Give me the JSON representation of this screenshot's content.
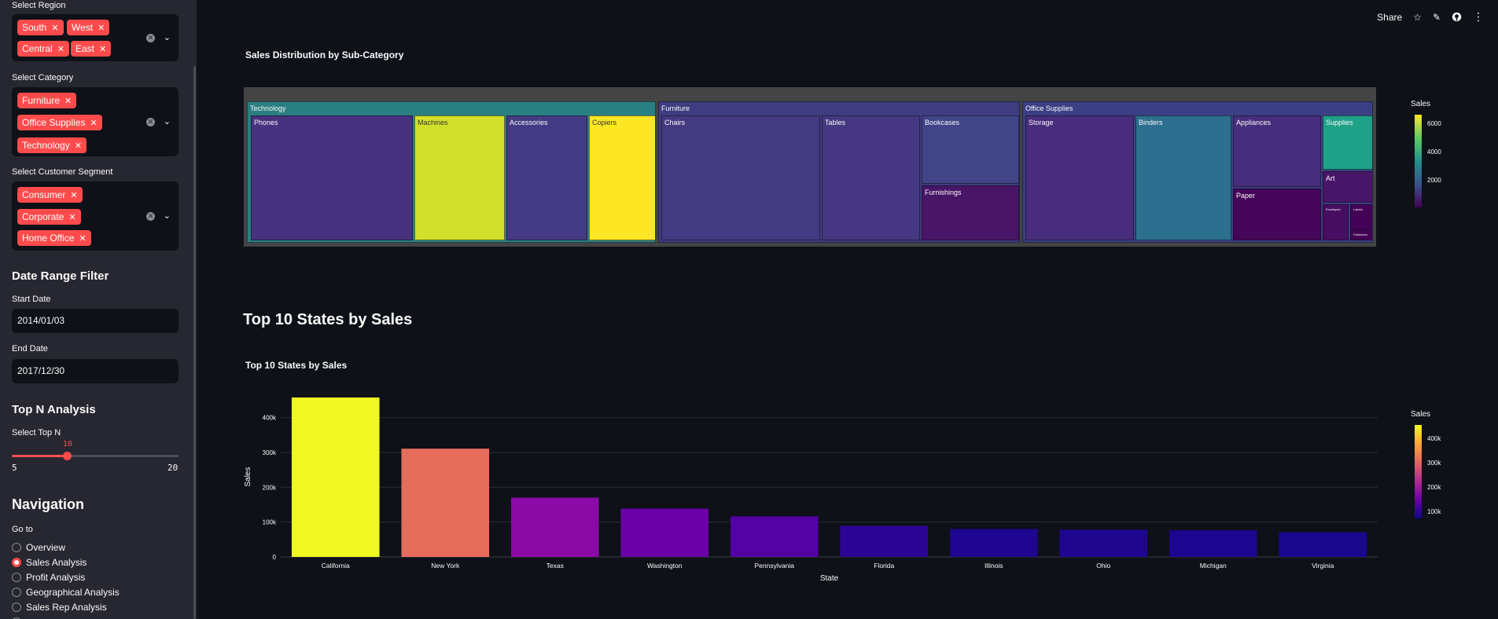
{
  "sidebar": {
    "region": {
      "label": "Select Region",
      "tags": [
        "South",
        "West",
        "Central",
        "East"
      ]
    },
    "category": {
      "label": "Select Category",
      "tags": [
        "Furniture",
        "Office Supplies",
        "Technology"
      ]
    },
    "segment": {
      "label": "Select Customer Segment",
      "tags": [
        "Consumer",
        "Corporate",
        "Home Office"
      ]
    },
    "date_range": {
      "heading": "Date Range Filter",
      "start_label": "Start Date",
      "start_value": "2014/01/03",
      "end_label": "End Date",
      "end_value": "2017/12/30"
    },
    "top_n": {
      "heading": "Top N Analysis",
      "label": "Select Top N",
      "value": "10",
      "min": "5",
      "max": "20"
    },
    "navigation": {
      "heading": "Navigation",
      "label": "Go to",
      "options": [
        "Overview",
        "Sales Analysis",
        "Profit Analysis",
        "Geographical Analysis",
        "Sales Rep Analysis"
      ],
      "selected": "Sales Analysis"
    }
  },
  "toolbar": {
    "share_label": "Share",
    "icons": [
      "star-icon",
      "pencil-icon",
      "github-icon",
      "more-vertical-icon"
    ]
  },
  "main": {
    "treemap": {
      "title": "Sales Distribution by Sub-Category",
      "colorbar_title": "Sales",
      "colorbar_ticks": [
        "6000",
        "4000",
        "2000"
      ],
      "groups": [
        {
          "name": "Technology",
          "color": "#2a7f82",
          "children": [
            {
              "name": "Phones",
              "color": "#46327e"
            },
            {
              "name": "Machines",
              "color": "#d2e02b"
            },
            {
              "name": "Accessories",
              "color": "#433a83"
            },
            {
              "name": "Copiers",
              "color": "#fde725"
            }
          ]
        },
        {
          "name": "Furniture",
          "color": "#3f3c7f",
          "children": [
            {
              "name": "Chairs",
              "color": "#433a82"
            },
            {
              "name": "Tables",
              "color": "#453781"
            },
            {
              "name": "Bookcases",
              "color": "#414487"
            },
            {
              "name": "Furnishings",
              "color": "#481567"
            }
          ]
        },
        {
          "name": "Office Supplies",
          "color": "#3b3f84",
          "children": [
            {
              "name": "Storage",
              "color": "#472d7b"
            },
            {
              "name": "Binders",
              "color": "#2d6f8e"
            },
            {
              "name": "Appliances",
              "color": "#472e7c"
            },
            {
              "name": "Supplies",
              "color": "#1fa187"
            },
            {
              "name": "Art",
              "color": "#481668"
            },
            {
              "name": "Paper",
              "color": "#450559"
            },
            {
              "name": "Envelopes",
              "color": "#470d60"
            },
            {
              "name": "Labels",
              "color": "#440256"
            },
            {
              "name": "Fasteners",
              "color": "#440154"
            }
          ]
        }
      ]
    },
    "section_heading": "Top 10 States by Sales",
    "bar_chart_title": "Top 10 States by Sales"
  },
  "chart_data": {
    "type": "bar",
    "title": "Top 10 States by Sales",
    "xlabel": "State",
    "ylabel": "Sales",
    "ylim": [
      0,
      460000
    ],
    "yticks": [
      0,
      100000,
      200000,
      300000,
      400000
    ],
    "ytick_labels": [
      "0",
      "100k",
      "200k",
      "300k",
      "400k"
    ],
    "categories": [
      "California",
      "New York",
      "Texas",
      "Washington",
      "Pennsylvania",
      "Florida",
      "Illinois",
      "Ohio",
      "Michigan",
      "Virginia"
    ],
    "values": [
      457688,
      310876,
      170188,
      138641,
      116512,
      89474,
      80166,
      78258,
      76270,
      70637
    ],
    "colors": [
      "#f0f921",
      "#e66c5c",
      "#8b0aa5",
      "#6a00a8",
      "#5302a3",
      "#2d0594",
      "#1f0690",
      "#1e068f",
      "#1d068f",
      "#1a078d"
    ],
    "colorbar_title": "Sales",
    "colorbar_ticks": [
      "400k",
      "300k",
      "200k",
      "100k"
    ],
    "grid": true
  }
}
